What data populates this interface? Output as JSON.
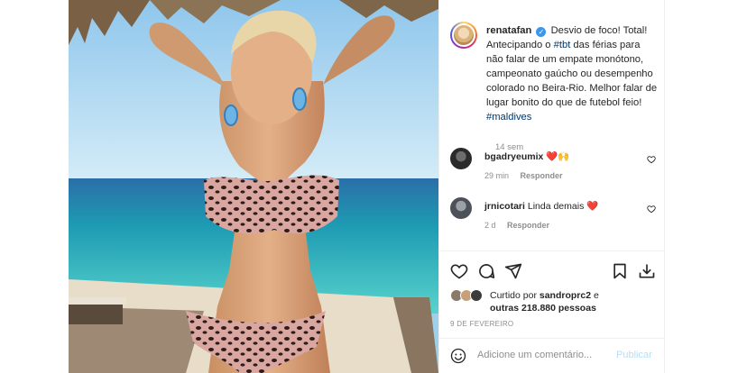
{
  "post": {
    "username": "renatafan",
    "caption_prefix": "Desvio de foco! Total! Antecipando o ",
    "hashtag_tbt": "#tbt",
    "caption_middle": " das férias para não falar de um empate monótono, campeonato gaúcho ou desempenho colorado no Beira-Rio. Melhor falar de lugar bonito do que de futebol feio! ",
    "hashtag_maldives": "#maldives",
    "time_ago": "14 sem",
    "verified_icon": "check"
  },
  "comments": [
    {
      "username": "bgadryeumix",
      "text": "❤️🙌",
      "time": "29 min",
      "reply": "Responder"
    },
    {
      "username": "jrnicotari",
      "text": "Linda demais ❤️",
      "time": "2 d",
      "reply": "Responder"
    }
  ],
  "likes": {
    "prefix": "Curtido por ",
    "user": "sandroprc2",
    "suffix": " e",
    "others": "outras 218.880 pessoas"
  },
  "date": "9 DE FEVEREIRO",
  "comment_box": {
    "placeholder": "Adicione um comentário...",
    "publish": "Publicar"
  },
  "colors": {
    "link": "#00376b",
    "muted": "#8e8e8e",
    "publish_disabled": "#b2dffc",
    "verified": "#3897f0"
  },
  "icons": [
    "heart-icon",
    "comment-icon",
    "share-icon",
    "bookmark-icon",
    "download-icon",
    "smile-icon"
  ]
}
